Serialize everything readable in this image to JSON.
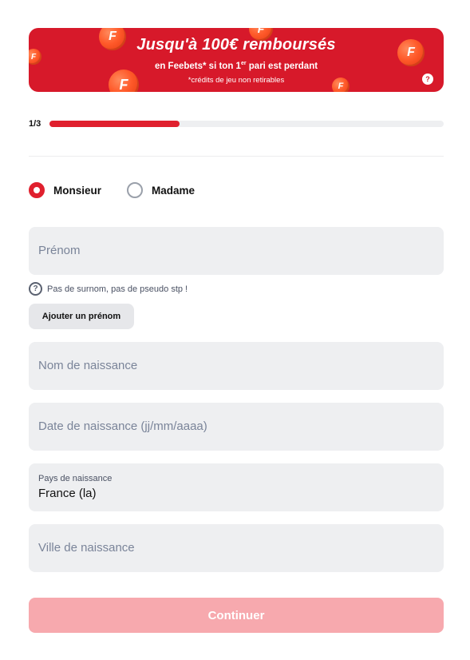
{
  "banner": {
    "title": "Jusqu'à 100€ remboursés",
    "subtitle_prefix": "en Feebets* si ton 1",
    "subtitle_sup": "er",
    "subtitle_suffix": " pari est perdant",
    "note": "*crédits de jeu non retirables",
    "help": "?",
    "coin_letter": "F",
    "background_color": "#d7192a"
  },
  "progress": {
    "step_label": "1/3",
    "fraction": 0.33,
    "fill_color": "#e0202e"
  },
  "gender": {
    "options": [
      {
        "label": "Monsieur",
        "selected": true
      },
      {
        "label": "Madame",
        "selected": false
      }
    ]
  },
  "form": {
    "first_name": {
      "placeholder": "Prénom"
    },
    "first_name_hint": {
      "icon": "?",
      "text": "Pas de surnom, pas de pseudo stp !"
    },
    "add_first_name_label": "Ajouter un prénom",
    "birth_name": {
      "placeholder": "Nom de naissance"
    },
    "birth_date": {
      "placeholder": "Date de naissance (jj/mm/aaaa)"
    },
    "birth_country": {
      "label": "Pays de naissance",
      "value": "France (la)"
    },
    "birth_city": {
      "placeholder": "Ville de naissance"
    }
  },
  "continue_label": "Continuer"
}
